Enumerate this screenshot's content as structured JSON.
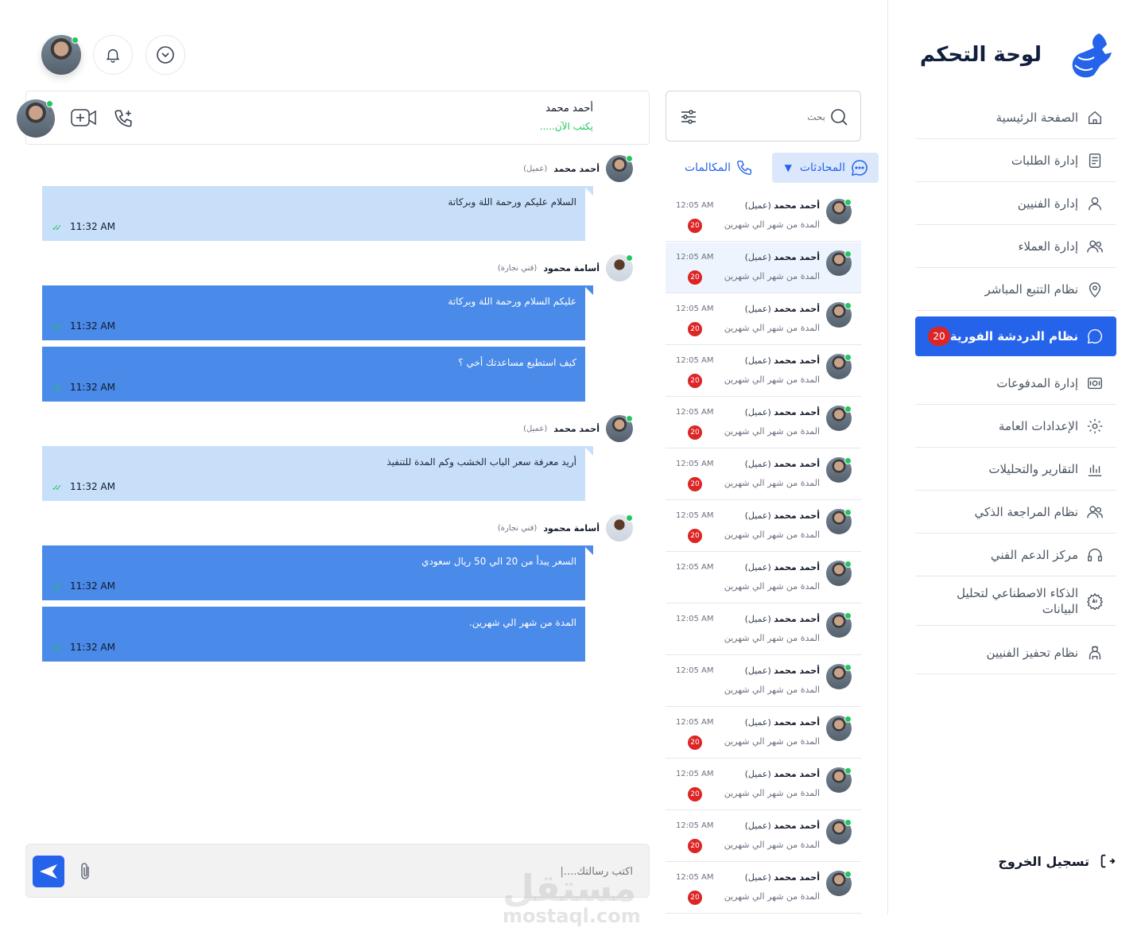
{
  "app": {
    "title": "لوحة التحكم"
  },
  "sidebar": {
    "items": [
      {
        "label": "الصفحة الرئيسية",
        "icon": "home-icon"
      },
      {
        "label": "إدارة الطلبات",
        "icon": "receipt-icon"
      },
      {
        "label": "إدارة الفنيين",
        "icon": "user-icon"
      },
      {
        "label": "إدارة العملاء",
        "icon": "users-icon"
      },
      {
        "label": "نظام التتبع المباشر",
        "icon": "location-pin-icon"
      },
      {
        "label": "نظام الدردشة الفورية",
        "icon": "chat-icon",
        "badge": "20",
        "active": true
      },
      {
        "label": "إدارة المدفوعات",
        "icon": "money-icon"
      },
      {
        "label": "الإعدادات العامة",
        "icon": "settings-icon"
      },
      {
        "label": "التقارير والتحليلات",
        "icon": "bar-chart-icon"
      },
      {
        "label": "نظام المراجعة الذكي",
        "icon": "users-review-icon"
      },
      {
        "label": "مركز الدعم الفني",
        "icon": "headset-icon"
      },
      {
        "label": "الذكاء الاصطناعي لتحليل البيانات",
        "icon": "ai-gear-icon"
      },
      {
        "label": "نظام تحفيز الفنيين",
        "icon": "technician-icon"
      }
    ],
    "logout_label": "تسجيل الخروج"
  },
  "conversations": {
    "search_placeholder": "بحث",
    "tab_chats": "المحادثات",
    "tab_calls": "المكالمات",
    "items": [
      {
        "name": "أحمد محمد",
        "role": "(عميل)",
        "preview": "المدة من  شهر الي شهرين",
        "time": "12:05  AM",
        "badge": "20"
      },
      {
        "name": "أحمد محمد",
        "role": "(عميل)",
        "preview": "المدة من  شهر الي شهرين",
        "time": "12:05  AM",
        "badge": "20"
      },
      {
        "name": "أحمد محمد",
        "role": "(عميل)",
        "preview": "المدة من  شهر الي شهرين",
        "time": "12:05  AM",
        "badge": "20"
      },
      {
        "name": "أحمد محمد",
        "role": "(عميل)",
        "preview": "المدة من  شهر الي شهرين",
        "time": "12:05  AM",
        "badge": "20"
      },
      {
        "name": "أحمد محمد",
        "role": "(عميل)",
        "preview": "المدة من  شهر الي شهرين",
        "time": "12:05  AM",
        "badge": "20"
      },
      {
        "name": "أحمد محمد",
        "role": "(عميل)",
        "preview": "المدة من  شهر الي شهرين",
        "time": "12:05  AM",
        "badge": "20"
      },
      {
        "name": "أحمد محمد",
        "role": "(عميل)",
        "preview": "المدة من  شهر الي شهرين",
        "time": "12:05  AM",
        "badge": "20"
      },
      {
        "name": "أحمد محمد",
        "role": "(عميل)",
        "preview": "المدة من  شهر الي شهرين",
        "time": "12:05  AM",
        "badge": ""
      },
      {
        "name": "أحمد محمد",
        "role": "(عميل)",
        "preview": "المدة من  شهر الي شهرين",
        "time": "12:05  AM",
        "badge": ""
      },
      {
        "name": "أحمد محمد",
        "role": "(عميل)",
        "preview": "المدة من  شهر الي شهرين",
        "time": "12:05  AM",
        "badge": ""
      },
      {
        "name": "أحمد محمد",
        "role": "(عميل)",
        "preview": "المدة من  شهر الي شهرين",
        "time": "12:05  AM",
        "badge": "20"
      },
      {
        "name": "أحمد محمد",
        "role": "(عميل)",
        "preview": "المدة من  شهر الي شهرين",
        "time": "12:05  AM",
        "badge": "20"
      },
      {
        "name": "أحمد محمد",
        "role": "(عميل)",
        "preview": "المدة من  شهر الي شهرين",
        "time": "12:05  AM",
        "badge": "20"
      },
      {
        "name": "أحمد محمد",
        "role": "(عميل)",
        "preview": "المدة من  شهر الي شهرين",
        "time": "12:05  AM",
        "badge": "20"
      }
    ]
  },
  "chat": {
    "contact_name": "أحمد محمد",
    "contact_status": "يكتب الآن.....",
    "messages": [
      {
        "sender": "أحمد محمد",
        "role": "(عميل)",
        "text": "السلام عليكم ورحمة اللة وبركاتة",
        "time": "11:32 AM",
        "style": "light"
      },
      {
        "sender": "أسامة محمود",
        "role": "(فني نجارة)",
        "text": "عليكم السلام ورحمة اللة وبركاتة",
        "time": "11:32 AM",
        "style": "blue"
      },
      {
        "sender": "",
        "role": "",
        "text": "كيف استطيع مساعدتك أخي ؟",
        "time": "11:32 AM",
        "style": "blue"
      },
      {
        "sender": "أحمد محمد",
        "role": "(عميل)",
        "text": "أريد معرفة سعر الباب الخشب وكم المدة للتنفيذ",
        "time": "11:32 AM",
        "style": "light"
      },
      {
        "sender": "أسامة محمود",
        "role": "(فني نجارة)",
        "text": "السعر يبدأ من 20 الي 50 ريال سعودي",
        "time": "11:32 AM",
        "style": "blue"
      },
      {
        "sender": "",
        "role": "",
        "text": "المدة من شهر الي شهرين.",
        "time": "11:32 AM",
        "style": "blue"
      }
    ],
    "composer_placeholder": "اكتب رسالتك....|"
  },
  "watermark": {
    "text": "مستقل",
    "domain": "mostaql.com"
  },
  "colors": {
    "accent": "#2563eb",
    "badge": "#dc2626",
    "online": "#22c55e",
    "light_bubble": "#c8dffa",
    "blue_bubble": "#4a8ae8"
  }
}
